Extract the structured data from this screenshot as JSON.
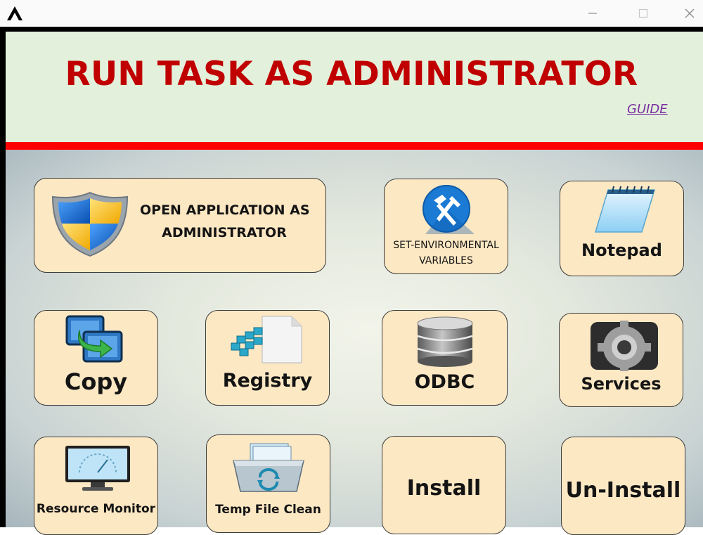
{
  "window": {
    "title": "RUN TASK AS ADMINISTRATOR",
    "controls": {
      "minimize": "—",
      "maximize": "☐",
      "close": "✕"
    }
  },
  "header": {
    "guide_label": "GUIDE"
  },
  "colors": {
    "title_red": "#c00000",
    "header_bg": "#e3f1dc",
    "separator_red": "#ff0000",
    "button_bg": "#fde8c4",
    "guide_link": "#7a2fa0"
  },
  "buttons": {
    "open_admin": {
      "line1": "OPEN APPLICATION AS",
      "line2": "ADMINISTRATOR",
      "icon": "shield-icon"
    },
    "env_vars": {
      "line1": "SET-ENVIRONMENTAL",
      "line2": "VARIABLES",
      "icon": "tools-icon"
    },
    "notepad": {
      "label": "Notepad",
      "icon": "notepad-icon"
    },
    "copy": {
      "label": "Copy",
      "icon": "copy-icon"
    },
    "registry": {
      "label": "Registry",
      "icon": "registry-icon"
    },
    "odbc": {
      "label": "ODBC",
      "icon": "database-icon"
    },
    "services": {
      "label": "Services",
      "icon": "gear-icon"
    },
    "resource_monitor": {
      "label": "Resource Monitor",
      "icon": "monitor-icon"
    },
    "temp_clean": {
      "label": "Temp File Clean",
      "icon": "temp-clean-icon"
    },
    "install": {
      "label": "Install"
    },
    "uninstall": {
      "label": "Un-Install"
    }
  }
}
